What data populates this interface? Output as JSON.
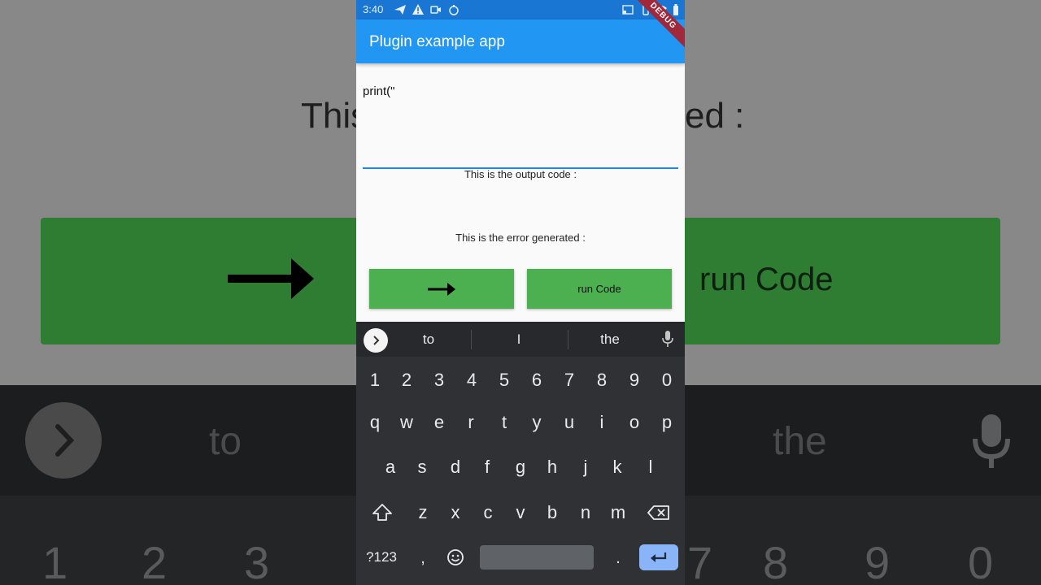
{
  "background": {
    "text_left": "This",
    "text_right": "ed :",
    "run_label": "run Code",
    "suggestions": [
      "to",
      "the"
    ],
    "digits": [
      "1",
      "2",
      "3",
      "7",
      "8",
      "9",
      "0"
    ]
  },
  "status": {
    "time": "3:40"
  },
  "app": {
    "title": "Plugin example app",
    "debug_banner": "DEBUG"
  },
  "editor": {
    "value": "print(\""
  },
  "output": {
    "label": "This is the output code :"
  },
  "error": {
    "label": "This is the error generated :"
  },
  "buttons": {
    "run_label": "run Code"
  },
  "keyboard": {
    "suggestions": [
      "to",
      "I",
      "the"
    ],
    "rows": [
      [
        "1",
        "2",
        "3",
        "4",
        "5",
        "6",
        "7",
        "8",
        "9",
        "0"
      ],
      [
        "q",
        "w",
        "e",
        "r",
        "t",
        "y",
        "u",
        "i",
        "o",
        "p"
      ],
      [
        "a",
        "s",
        "d",
        "f",
        "g",
        "h",
        "j",
        "k",
        "l"
      ],
      [
        "z",
        "x",
        "c",
        "v",
        "b",
        "n",
        "m"
      ]
    ],
    "symbols_label": "?123",
    "comma": ",",
    "period": "."
  },
  "colors": {
    "appbar": "#2196f3",
    "statusbar": "#1976d2",
    "button": "#4caf50",
    "keyboard": "#303134",
    "enter_key": "#8ab4f8"
  }
}
